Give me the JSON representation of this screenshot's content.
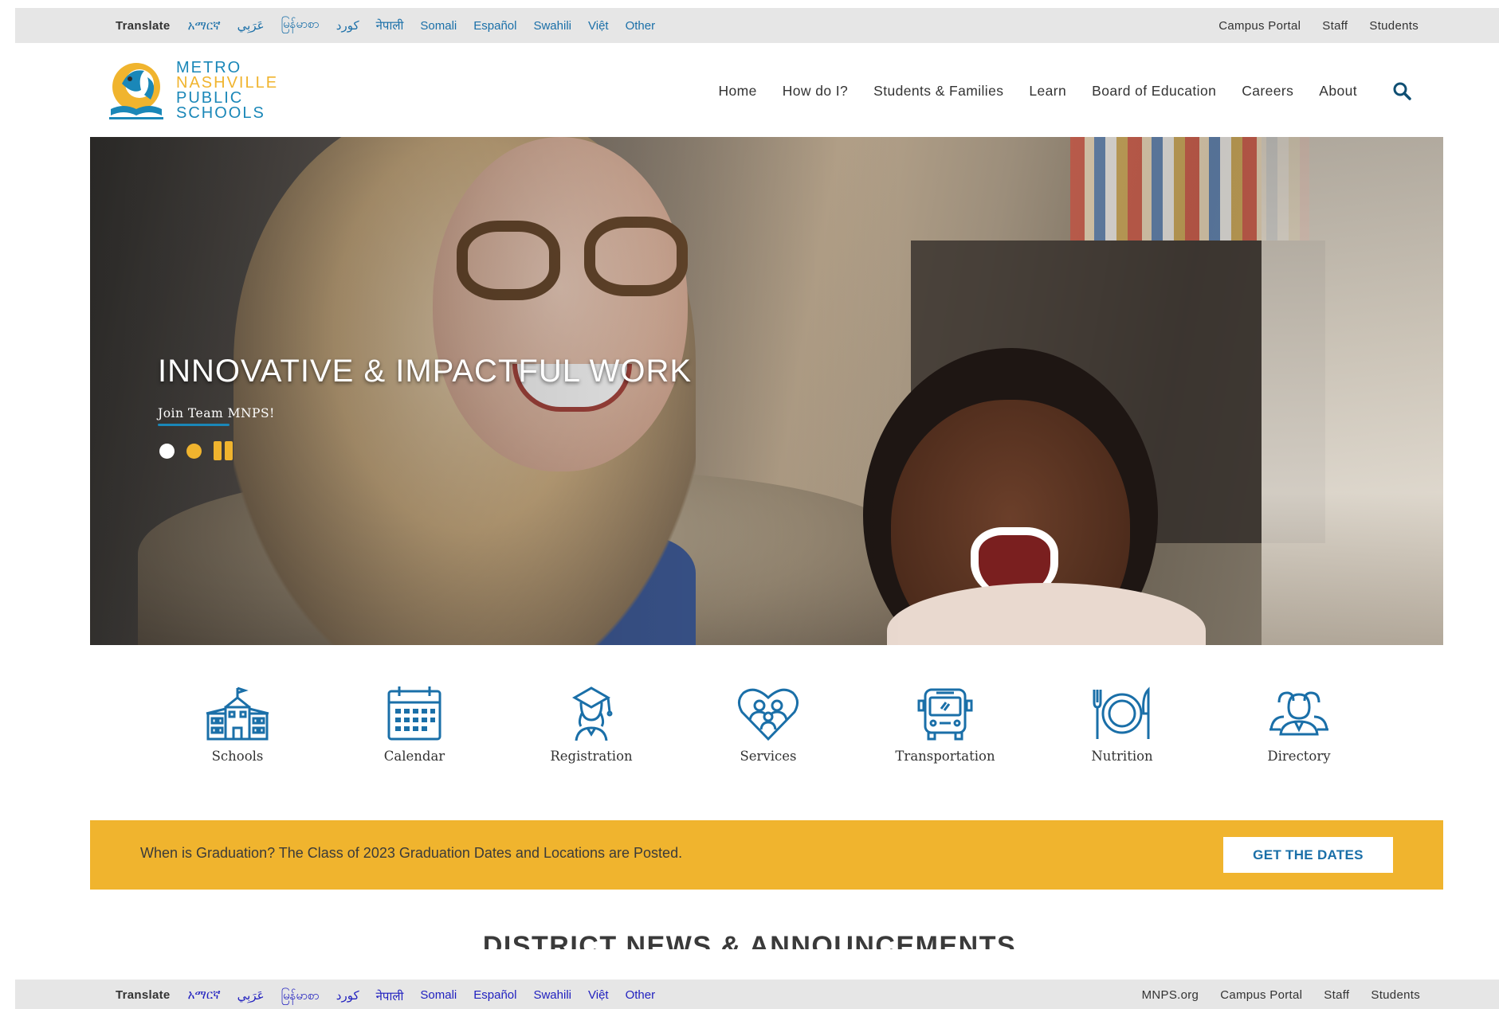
{
  "topbar": {
    "translate_label": "Translate",
    "languages": [
      "አማርኛ",
      "عَرَبِي",
      "မြန်မာစာ",
      "كورد",
      "नेपाली",
      "Somali",
      "Español",
      "Swahili",
      "Việt",
      "Other"
    ],
    "right_links": [
      "Campus Portal",
      "Staff",
      "Students"
    ]
  },
  "logo": {
    "lines": [
      "METRO",
      "NASHVILLE",
      "PUBLIC",
      "SCHOOLS"
    ]
  },
  "nav": {
    "items": [
      "Home",
      "How do I?",
      "Students & Families",
      "Learn",
      "Board of Education",
      "Careers",
      "About"
    ],
    "search_icon": "search-icon"
  },
  "hero": {
    "title": "INNOVATIVE & IMPACTFUL WORK",
    "link": "Join Team MNPS!"
  },
  "quick_links": [
    {
      "label": "Schools",
      "icon": "school-building-icon"
    },
    {
      "label": "Calendar",
      "icon": "calendar-icon"
    },
    {
      "label": "Registration",
      "icon": "graduate-icon"
    },
    {
      "label": "Services",
      "icon": "heart-family-icon"
    },
    {
      "label": "Transportation",
      "icon": "bus-icon"
    },
    {
      "label": "Nutrition",
      "icon": "plate-utensils-icon"
    },
    {
      "label": "Directory",
      "icon": "people-icon"
    }
  ],
  "banner": {
    "text": "When is Graduation? The Class of 2023 Graduation Dates and Locations are Posted.",
    "button": "GET THE DATES"
  },
  "news": {
    "title": "DISTRICT NEWS & ANNOUNCEMENTS"
  },
  "bottombar": {
    "translate_label": "Translate",
    "languages": [
      "አማርኛ",
      "عَرَبِي",
      "မြန်မာစာ",
      "كورد",
      "नेपाली",
      "Somali",
      "Español",
      "Swahili",
      "Việt",
      "Other"
    ],
    "right_links": [
      "MNPS.org",
      "Campus Portal",
      "Staff",
      "Students"
    ]
  },
  "colors": {
    "blue": "#1a87b8",
    "link_blue": "#1a6fa8",
    "gold": "#f0b42e",
    "bar_gray": "#e6e6e6"
  }
}
